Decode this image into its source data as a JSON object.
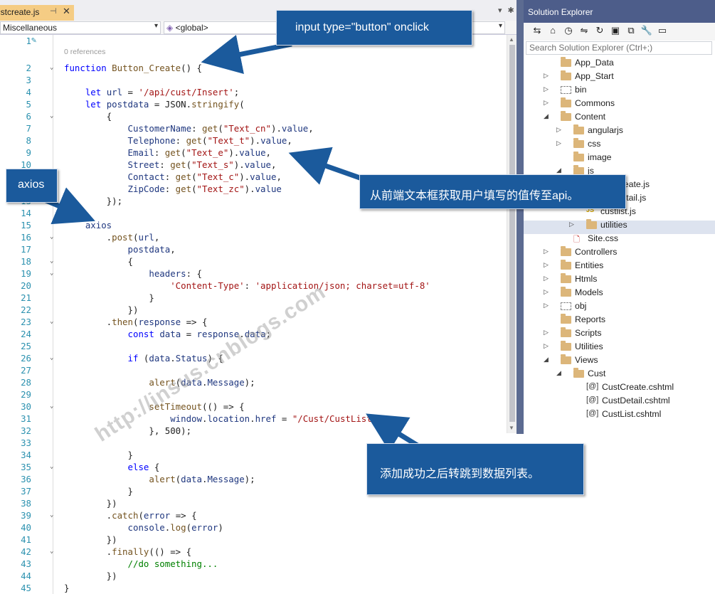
{
  "editor": {
    "tab_title": "ustcreate.js",
    "tab_pin": "⊣",
    "tab_close": "✕",
    "tab_controls": [
      "▾",
      "✱"
    ],
    "nav_combo1": "Miscellaneous",
    "nav_combo2": "<global>",
    "split_icon": "✛",
    "references_label": "0 references",
    "lines": [
      {
        "n": "1",
        "html": ""
      },
      {
        "n": "2",
        "html": "<span class=\"kw\">function</span> <span class=\"fn\">Button_Create</span>() {"
      },
      {
        "n": "3",
        "html": ""
      },
      {
        "n": "4",
        "html": "    <span class=\"kw\">let</span> <span class=\"pr\">url</span> = <span class=\"str\">'/api/cust/Insert'</span>;"
      },
      {
        "n": "5",
        "html": "    <span class=\"kw\">let</span> <span class=\"pr\">postdata</span> = JSON.<span class=\"fn\">stringify</span>("
      },
      {
        "n": "6",
        "html": "        {"
      },
      {
        "n": "7",
        "html": "            <span class=\"pr\">CustomerName</span>: <span class=\"fn\">get</span>(<span class=\"str\">\"Text_cn\"</span>).<span class=\"pr\">value</span>,"
      },
      {
        "n": "8",
        "html": "            <span class=\"pr\">Telephone</span>: <span class=\"fn\">get</span>(<span class=\"str\">\"Text_t\"</span>).<span class=\"pr\">value</span>,"
      },
      {
        "n": "9",
        "html": "            <span class=\"pr\">Email</span>: <span class=\"fn\">get</span>(<span class=\"str\">\"Text_e\"</span>).<span class=\"pr\">value</span>,"
      },
      {
        "n": "10",
        "html": "            <span class=\"pr\">Street</span>: <span class=\"fn\">get</span>(<span class=\"str\">\"Text_s\"</span>).<span class=\"pr\">value</span>,"
      },
      {
        "n": "11",
        "html": "            <span class=\"pr\">Contact</span>: <span class=\"fn\">get</span>(<span class=\"str\">\"Text_c\"</span>).<span class=\"pr\">value</span>,"
      },
      {
        "n": "12",
        "html": "            <span class=\"pr\">ZipCode</span>: <span class=\"fn\">get</span>(<span class=\"str\">\"Text_zc\"</span>).<span class=\"pr\">value</span>"
      },
      {
        "n": "13",
        "html": "        });"
      },
      {
        "n": "14",
        "html": ""
      },
      {
        "n": "15",
        "html": "    <span class=\"pr\">axios</span>"
      },
      {
        "n": "16",
        "html": "        .<span class=\"fn\">post</span>(<span class=\"pr\">url</span>,"
      },
      {
        "n": "17",
        "html": "            <span class=\"pr\">postdata</span>,"
      },
      {
        "n": "18",
        "html": "            {"
      },
      {
        "n": "19",
        "html": "                <span class=\"pr\">headers</span>: {"
      },
      {
        "n": "20",
        "html": "                    <span class=\"str\">'Content-Type'</span>: <span class=\"str\">'application/json; charset=utf-8'</span>"
      },
      {
        "n": "21",
        "html": "                }"
      },
      {
        "n": "22",
        "html": "            })"
      },
      {
        "n": "23",
        "html": "        .<span class=\"fn\">then</span>(<span class=\"pr\">response</span> => {"
      },
      {
        "n": "24",
        "html": "            <span class=\"kw\">const</span> <span class=\"pr\">data</span> = <span class=\"pr\">response</span>.<span class=\"pr\">data</span>;"
      },
      {
        "n": "25",
        "html": ""
      },
      {
        "n": "26",
        "html": "            <span class=\"kw\">if</span> (<span class=\"pr\">data</span>.<span class=\"pr\">Status</span>) {"
      },
      {
        "n": "27",
        "html": ""
      },
      {
        "n": "28",
        "html": "                <span class=\"fn\">alert</span>(<span class=\"pr\">data</span>.<span class=\"pr\">Message</span>);"
      },
      {
        "n": "29",
        "html": ""
      },
      {
        "n": "30",
        "html": "                <span class=\"fn\">setTimeout</span>(() => {"
      },
      {
        "n": "31",
        "html": "                    <span class=\"pr\">window</span>.<span class=\"pr\">location</span>.<span class=\"pr\">href</span> = <span class=\"str\">\"/Cust/CustList\"</span>;"
      },
      {
        "n": "32",
        "html": "                }, 500);"
      },
      {
        "n": "33",
        "html": ""
      },
      {
        "n": "34",
        "html": "            }"
      },
      {
        "n": "35",
        "html": "            <span class=\"kw\">else</span> {"
      },
      {
        "n": "36",
        "html": "                <span class=\"fn\">alert</span>(<span class=\"pr\">data</span>.<span class=\"pr\">Message</span>);"
      },
      {
        "n": "37",
        "html": "            }"
      },
      {
        "n": "38",
        "html": "        })"
      },
      {
        "n": "39",
        "html": "        .<span class=\"fn\">catch</span>(<span class=\"pr\">error</span> => {"
      },
      {
        "n": "40",
        "html": "            <span class=\"pr\">console</span>.<span class=\"fn\">log</span>(<span class=\"pr\">error</span>)"
      },
      {
        "n": "41",
        "html": "        })"
      },
      {
        "n": "42",
        "html": "        .<span class=\"fn\">finally</span>(() => {"
      },
      {
        "n": "43",
        "html": "            <span class=\"cm\">//do something...</span>"
      },
      {
        "n": "44",
        "html": "        })"
      },
      {
        "n": "45",
        "html": "}"
      }
    ],
    "fold_lines": [
      "2",
      "6",
      "16",
      "18",
      "19",
      "23",
      "26",
      "30",
      "35",
      "39",
      "42"
    ]
  },
  "solution_explorer": {
    "title": "Solution Explorer",
    "search_placeholder": "Search Solution Explorer (Ctrl+;)",
    "tree": [
      {
        "label": "App_Data",
        "depth": 0,
        "exp": "",
        "icon": "folder"
      },
      {
        "label": "App_Start",
        "depth": 0,
        "exp": "▷",
        "icon": "folder"
      },
      {
        "label": "bin",
        "depth": 0,
        "exp": "▷",
        "icon": "dash"
      },
      {
        "label": "Commons",
        "depth": 0,
        "exp": "▷",
        "icon": "folder"
      },
      {
        "label": "Content",
        "depth": 0,
        "exp": "◢",
        "icon": "folder"
      },
      {
        "label": "angularjs",
        "depth": 1,
        "exp": "▷",
        "icon": "folder"
      },
      {
        "label": "css",
        "depth": 1,
        "exp": "▷",
        "icon": "folder"
      },
      {
        "label": "image",
        "depth": 1,
        "exp": "",
        "icon": "folder"
      },
      {
        "label": "js",
        "depth": 1,
        "exp": "◢",
        "icon": "folder"
      },
      {
        "label": "custcreate.js",
        "depth": 2,
        "exp": "",
        "icon": "js"
      },
      {
        "label": "custdetail.js",
        "depth": 2,
        "exp": "",
        "icon": "js"
      },
      {
        "label": "custlist.js",
        "depth": 2,
        "exp": "",
        "icon": "js"
      },
      {
        "label": "utilities",
        "depth": 2,
        "exp": "▷",
        "icon": "folder"
      },
      {
        "label": "Site.css",
        "depth": 1,
        "exp": "",
        "icon": "css"
      },
      {
        "label": "Controllers",
        "depth": 0,
        "exp": "▷",
        "icon": "folder"
      },
      {
        "label": "Entities",
        "depth": 0,
        "exp": "▷",
        "icon": "folder"
      },
      {
        "label": "Htmls",
        "depth": 0,
        "exp": "▷",
        "icon": "folder"
      },
      {
        "label": "Models",
        "depth": 0,
        "exp": "▷",
        "icon": "folder"
      },
      {
        "label": "obj",
        "depth": 0,
        "exp": "▷",
        "icon": "dash"
      },
      {
        "label": "Reports",
        "depth": 0,
        "exp": "",
        "icon": "folder"
      },
      {
        "label": "Scripts",
        "depth": 0,
        "exp": "▷",
        "icon": "folder"
      },
      {
        "label": "Utilities",
        "depth": 0,
        "exp": "▷",
        "icon": "folder"
      },
      {
        "label": "Views",
        "depth": 0,
        "exp": "◢",
        "icon": "folder"
      },
      {
        "label": "Cust",
        "depth": 1,
        "exp": "◢",
        "icon": "folder"
      },
      {
        "label": "CustCreate.cshtml",
        "depth": 2,
        "exp": "",
        "icon": "cshtml"
      },
      {
        "label": "CustDetail.cshtml",
        "depth": 2,
        "exp": "",
        "icon": "cshtml"
      },
      {
        "label": "CustList.cshtml",
        "depth": 2,
        "exp": "",
        "icon": "cshtml"
      }
    ],
    "toolbar_icons": [
      "⇆",
      "⌂",
      "◷",
      "⇋",
      "↻",
      "▣",
      "⧉",
      "🔧",
      "▭"
    ]
  },
  "callouts": {
    "c1": "input type=\"button\" onclick",
    "c2": "axios",
    "c3": "从前端文本框获取用户填写的值传至api。",
    "c4": "添加成功之后转跳到数据列表。"
  },
  "watermark": "http://insus.cnblogs.com",
  "colors": {
    "callout": "#1b5a9c",
    "keyword": "#0000ff",
    "string": "#a31515",
    "tab_active": "#f5cc84"
  }
}
